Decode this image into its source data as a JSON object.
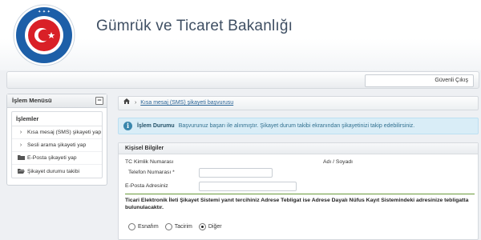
{
  "header": {
    "title": "Gümrük ve Ticaret Bakanlığı",
    "logo_icon": "ministry-seal-icon"
  },
  "topbar": {
    "logout_label": "Güvenli Çıkış"
  },
  "sidebar": {
    "title": "İşlem Menüsü",
    "collapse_symbol": "−",
    "section_title": "İşlemler",
    "items": [
      {
        "label": "Kısa mesaj (SMS) şikayeti yap",
        "icon": "chevron-right-icon"
      },
      {
        "label": "Sesli arama şikayeti yap",
        "icon": "chevron-right-icon"
      },
      {
        "label": "E-Posta şikayeti yap",
        "icon": "folder-icon"
      },
      {
        "label": "Şikayet durumu takibi",
        "icon": "folder-open-icon"
      }
    ]
  },
  "breadcrumb": {
    "home_icon": "home-icon",
    "separator": "›",
    "link_label": "Kısa mesaj (SMS) şikayeti başvurusu"
  },
  "info": {
    "icon": "info-icon",
    "title": "İşlem Durumu",
    "message": "Başvurunuz başarı ile alınmıştır. Şikayet durum takibi ekranından şikayetinizi takip edebilirsiniz."
  },
  "personal": {
    "title": "Kişisel Bilgiler",
    "tc_label": "TC Kimlik Numarası",
    "name_label": "Adı / Soyadı",
    "phone_label": "Telefon Numarası *",
    "email_label": "E-Posta Adresiniz",
    "tc_value": "",
    "name_value": "",
    "phone_value": "",
    "email_value": ""
  },
  "notice": {
    "text": "Ticari Elektronik İleti Şikayet Sistemi yanıt tercihiniz Adrese Tebligat ise Adrese Dayalı Nüfus Kayıt Sistemindeki adresinize tebligatta bulunulacaktır."
  },
  "radios": {
    "options": [
      "Esnafım",
      "Tacirim",
      "Diğer"
    ],
    "selected": "Diğer"
  },
  "colors": {
    "info_bg": "#d9edf7",
    "link": "#2a6496",
    "header_title": "#3f4f63",
    "divider": "#6a9a3a"
  }
}
